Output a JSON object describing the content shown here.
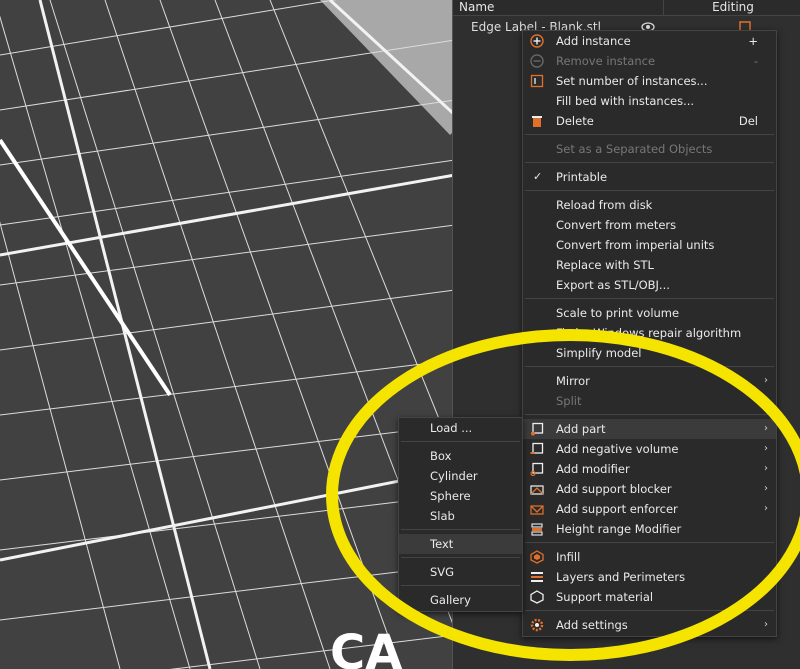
{
  "panel": {
    "col_name": "Name",
    "col_editing": "Editing",
    "object_label": "Edge Label - Blank.stl"
  },
  "context_menu": {
    "add_instance": {
      "label": "Add instance",
      "shortcut": "+"
    },
    "remove_instance": {
      "label": "Remove instance",
      "shortcut": "-"
    },
    "set_instances": {
      "label": "Set number of instances..."
    },
    "fill_bed": {
      "label": "Fill bed with instances..."
    },
    "delete": {
      "label": "Delete",
      "shortcut": "Del"
    },
    "set_separated": {
      "label": "Set as a Separated Objects"
    },
    "printable": {
      "label": "Printable",
      "check": "✓"
    },
    "reload": {
      "label": "Reload from disk"
    },
    "convert_meters": {
      "label": "Convert from meters"
    },
    "convert_imperial": {
      "label": "Convert from imperial units"
    },
    "replace_stl": {
      "label": "Replace with STL"
    },
    "export": {
      "label": "Export as STL/OBJ..."
    },
    "scale": {
      "label": "Scale to print volume"
    },
    "fix_windows": {
      "label": "Fix by Windows repair algorithm"
    },
    "simplify": {
      "label": "Simplify model"
    },
    "mirror": {
      "label": "Mirror"
    },
    "split": {
      "label": "Split"
    },
    "add_part": {
      "label": "Add part"
    },
    "add_negative": {
      "label": "Add negative volume"
    },
    "add_modifier": {
      "label": "Add modifier"
    },
    "add_blocker": {
      "label": "Add support blocker"
    },
    "add_enforcer": {
      "label": "Add support enforcer"
    },
    "height_range": {
      "label": "Height range Modifier"
    },
    "infill": {
      "label": "Infill"
    },
    "layers": {
      "label": "Layers and Perimeters"
    },
    "support": {
      "label": "Support material"
    },
    "add_settings": {
      "label": "Add settings"
    }
  },
  "submenu": {
    "load": "Load ...",
    "box": "Box",
    "cylinder": "Cylinder",
    "sphere": "Sphere",
    "slab": "Slab",
    "text": "Text",
    "svg": "SVG",
    "gallery": "Gallery"
  },
  "colors": {
    "accent_orange": "#e0702a",
    "highlight_yellow": "#f4e400",
    "bed_gray": "#404040",
    "menu_bg": "#2a2a2a"
  },
  "icons": {
    "eye": "eye-icon",
    "settings": "settings-icon",
    "check": "check-icon",
    "arrow": "submenu-arrow-icon"
  }
}
